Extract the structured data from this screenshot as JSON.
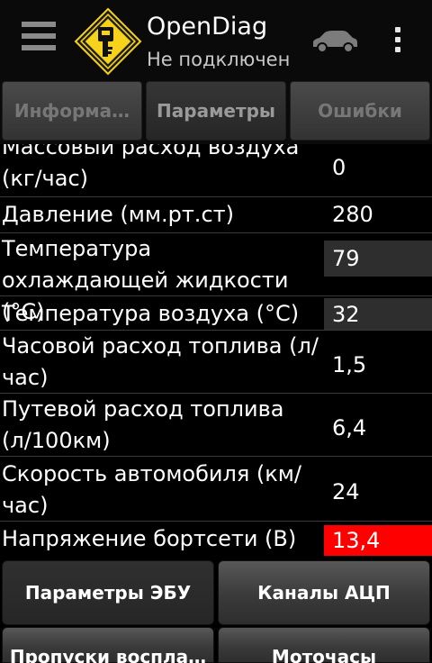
{
  "app": {
    "title": "OpenDiag",
    "status": "Не подключен"
  },
  "tabs": [
    {
      "label": "Информа…",
      "active": false
    },
    {
      "label": "Параметры",
      "active": true
    },
    {
      "label": "Ошибки",
      "active": false
    }
  ],
  "parameters": [
    {
      "label": "Массовый расход воздуха (кг/час)",
      "value": "0"
    },
    {
      "label": "Давление (мм.рт.ст)",
      "value": "280"
    },
    {
      "label": "Температура охлаждающей жидкости (°C)",
      "value": "79"
    },
    {
      "label": "Температура воздуха (°C)",
      "value": "32"
    },
    {
      "label": "Часовой расход топлива (л/час)",
      "value": "1,5"
    },
    {
      "label": "Путевой расход топлива (л/100км)",
      "value": "6,4"
    },
    {
      "label": "Скорость автомобиля (км/час)",
      "value": "24"
    },
    {
      "label": "Напряжение бортсети (В)",
      "value": "13,4"
    }
  ],
  "buttons": {
    "ecu_params": "Параметры ЭБУ",
    "adc_channels": "Каналы АЦП",
    "misfires": "Пропуски воспла…",
    "engine_hours": "Моточасы"
  },
  "colors": {
    "alert": "#ff0000",
    "logo_fill": "#f7d21a"
  },
  "icons": {
    "menu": "hamburger-icon",
    "logo": "key-diamond-icon",
    "car": "car-icon",
    "overflow": "overflow-icon"
  }
}
